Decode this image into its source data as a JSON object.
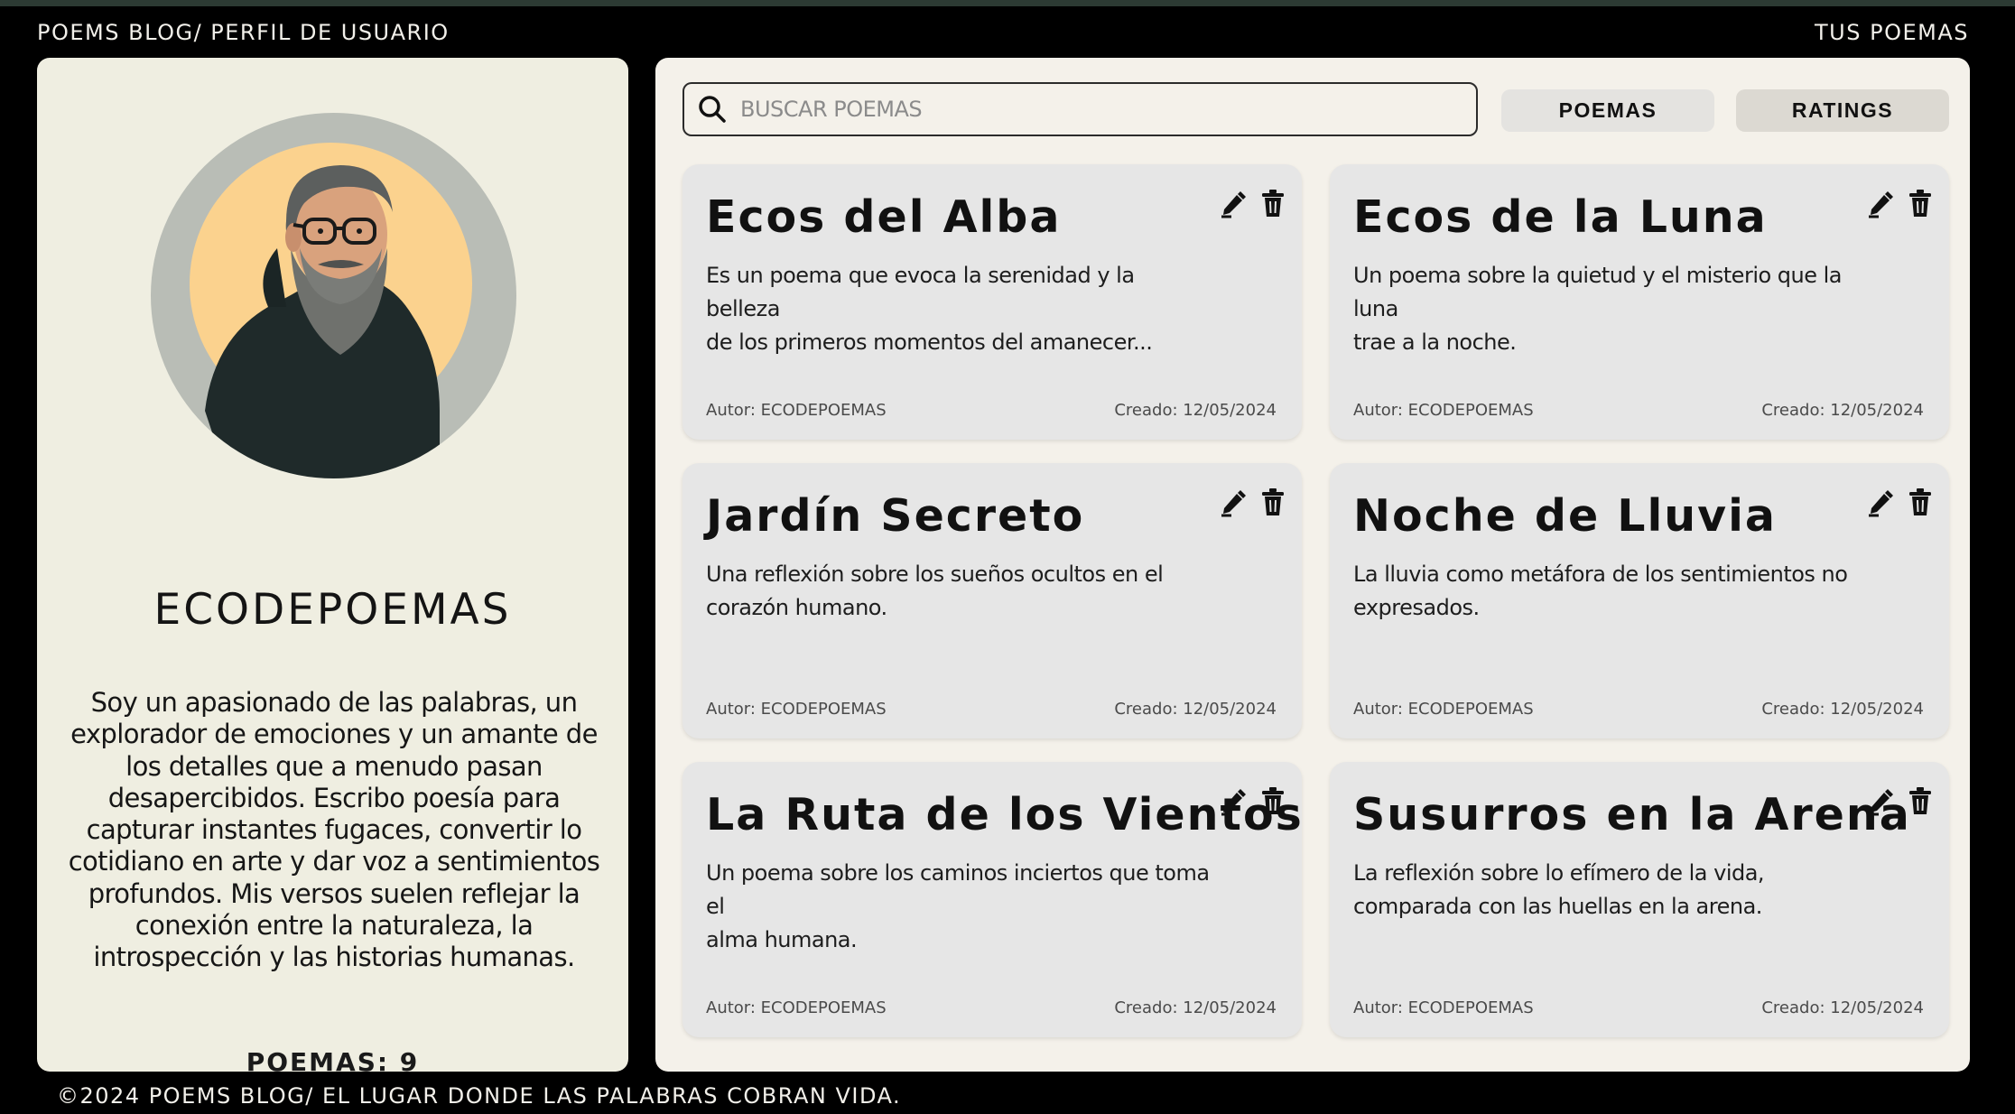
{
  "header": {
    "title": "POEMS BLOG/ PERFIL DE USUARIO",
    "nav_link": "TUS POEMAS"
  },
  "profile": {
    "username": "ECODEPOEMAS",
    "bio_lines": [
      "Soy un apasionado de las palabras, un",
      "explorador de emociones y un amante de",
      "los detalles que a menudo pasan",
      "desapercibidos. Escribo poesía para",
      "capturar instantes fugaces, convertir lo",
      "cotidiano en arte y dar voz a sentimientos",
      "profundos. Mis versos suelen reflejar la",
      "conexión entre la naturaleza, la",
      "introspección y las historias humanas."
    ],
    "poem_count": "POEMAS: 9",
    "avatar_icon": "bearded-man-avatar"
  },
  "search": {
    "placeholder": "BUSCAR POEMAS",
    "value": "",
    "icon": "search-icon"
  },
  "tabs": {
    "poemas": "POEMAS",
    "ratings": "RATINGS"
  },
  "poems": [
    {
      "title": "Ecos del Alba",
      "desc_lines": [
        "Es un poema que evoca la serenidad y la belleza",
        "de los primeros momentos del amanecer..."
      ],
      "author": "Autor: ECODEPOEMAS",
      "created": "Creado: 12/05/2024"
    },
    {
      "title": "Ecos de la Luna",
      "desc_lines": [
        "Un poema sobre la quietud y el misterio que la luna",
        "trae a la noche."
      ],
      "author": "Autor: ECODEPOEMAS",
      "created": "Creado: 12/05/2024"
    },
    {
      "title": "Jardín Secreto",
      "desc_lines": [
        "Una reflexión sobre los sueños ocultos en el",
        "corazón humano."
      ],
      "author": "Autor: ECODEPOEMAS",
      "created": "Creado: 12/05/2024"
    },
    {
      "title": "Noche de Lluvia",
      "desc_lines": [
        "La lluvia como metáfora de los sentimientos no",
        "expresados."
      ],
      "author": "Autor: ECODEPOEMAS",
      "created": "Creado: 12/05/2024"
    },
    {
      "title": "La Ruta de los Vientos",
      "desc_lines": [
        "Un poema sobre los caminos inciertos que toma el",
        "alma humana."
      ],
      "author": "Autor: ECODEPOEMAS",
      "created": "Creado: 12/05/2024"
    },
    {
      "title": "Susurros en la Arena",
      "desc_lines": [
        "La reflexión sobre lo efímero de la vida,",
        "comparada con las huellas en la arena."
      ],
      "author": "Autor: ECODEPOEMAS",
      "created": "Creado: 12/05/2024"
    }
  ],
  "card_icons": {
    "edit": "pencil-icon",
    "delete": "trash-icon"
  },
  "footer": {
    "text": "©2024 POEMS BLOG/ EL LUGAR DONDE LAS PALABRAS COBRAN VIDA."
  },
  "colors": {
    "background": "#000000",
    "profile_panel": "#efeee1",
    "main_panel": "#f4f1ea",
    "card": "#e6e6e6",
    "avatar_ring": "#b9bdb6",
    "avatar_sun": "#fbd28e"
  }
}
